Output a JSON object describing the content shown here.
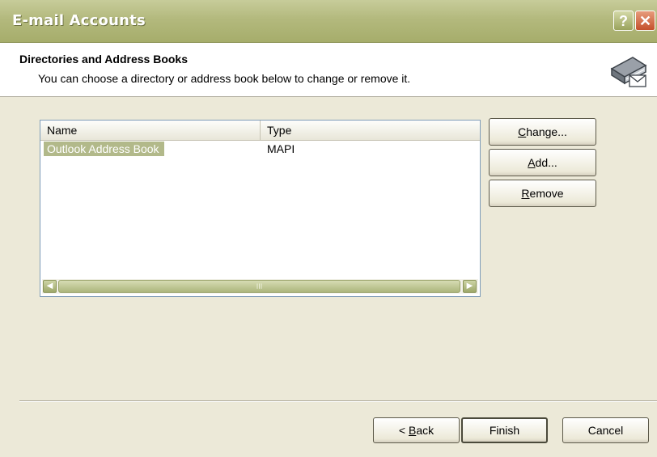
{
  "window": {
    "title": "E-mail Accounts",
    "help_glyph": "?",
    "close_glyph": "✕"
  },
  "header": {
    "title": "Directories and Address Books",
    "subtitle": "You can choose a directory or address book below to change or remove it.",
    "icon": "address-book-envelope-icon"
  },
  "list": {
    "columns": [
      "Name",
      "Type"
    ],
    "rows": [
      {
        "name": "Outlook Address Book",
        "type": "MAPI",
        "selected": true
      }
    ],
    "scrollbar_grip": "III"
  },
  "side_buttons": {
    "change": {
      "pre": "",
      "mnemonic": "C",
      "post": "hange..."
    },
    "add": {
      "pre": "",
      "mnemonic": "A",
      "post": "dd..."
    },
    "remove": {
      "pre": "",
      "mnemonic": "R",
      "post": "emove"
    }
  },
  "footer": {
    "back": {
      "pre": "< ",
      "mnemonic": "B",
      "post": "ack"
    },
    "finish_label": "Finish",
    "cancel_label": "Cancel"
  },
  "colors": {
    "title_bar": "#b3b97d",
    "selection": "#b2b98a",
    "dialog_bg": "#ece9d8"
  }
}
